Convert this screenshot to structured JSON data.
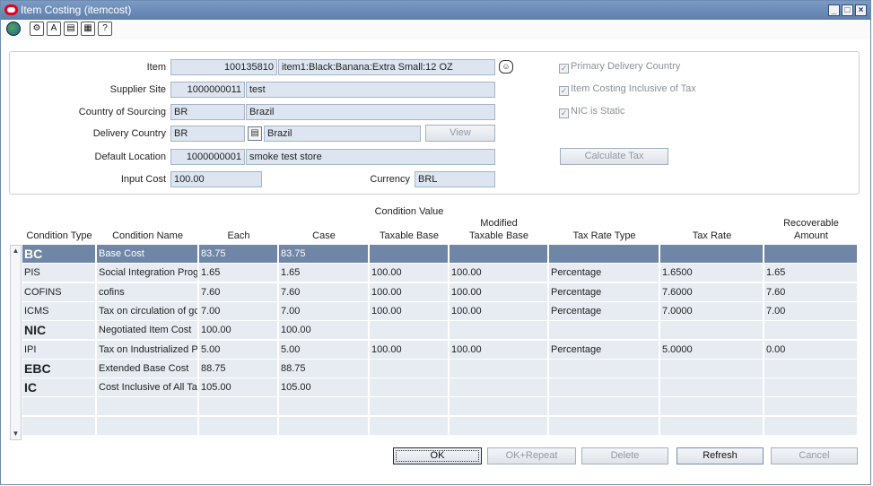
{
  "window": {
    "title": "Item Costing (itemcost)"
  },
  "toolbar": {
    "icons": [
      "globe-icon",
      "settings-icon",
      "find-icon",
      "clipboard-icon",
      "document-icon",
      "help-icon"
    ],
    "glyphs": [
      "",
      "⚙",
      "A",
      "▤",
      "▦",
      "?"
    ]
  },
  "form": {
    "item_label": "Item",
    "item_id": "100135810",
    "item_desc": "item1:Black:Banana:Extra Small:12 OZ",
    "supplier_site_label": "Supplier Site",
    "supplier_site_id": "1000000011",
    "supplier_site_name": "test",
    "country_sourcing_label": "Country of Sourcing",
    "country_sourcing_code": "BR",
    "country_sourcing_name": "Brazil",
    "delivery_country_label": "Delivery Country",
    "delivery_country_code": "BR",
    "delivery_country_name": "Brazil",
    "view_button": "View",
    "default_location_label": "Default Location",
    "default_location_id": "1000000001",
    "default_location_name": "smoke test store",
    "input_cost_label": "Input Cost",
    "input_cost": "100.00",
    "currency_label": "Currency",
    "currency": "BRL",
    "primary_delivery_country": "Primary Delivery Country",
    "item_costing_inclusive": "Item Costing Inclusive of Tax",
    "nic_is_static": "NIC is Static",
    "calculate_tax_button": "Calculate Tax"
  },
  "grid": {
    "group_header": "Condition Value",
    "columns": {
      "condition_type": "Condition Type",
      "condition_name": "Condition Name",
      "each": "Each",
      "case": "Case",
      "taxable_base": "Taxable Base",
      "modified_line1": "Modified",
      "modified_line2": "Taxable Base",
      "tax_rate_type": "Tax Rate Type",
      "tax_rate": "Tax Rate",
      "recoverable_line1": "Recoverable",
      "recoverable_line2": "Amount"
    },
    "rows": [
      {
        "type": "BC",
        "name": "Base Cost",
        "each": "83.75",
        "case": "83.75",
        "taxable_base": "",
        "modified_base": "",
        "rate_type": "",
        "rate": "",
        "recoverable": "",
        "big": true,
        "selected": true
      },
      {
        "type": "PIS",
        "name": "Social Integration Progr",
        "each": "1.65",
        "case": "1.65",
        "taxable_base": "100.00",
        "modified_base": "100.00",
        "rate_type": "Percentage",
        "rate": "1.6500",
        "recoverable": "1.65",
        "big": false
      },
      {
        "type": "COFINS",
        "name": "cofins",
        "each": "7.60",
        "case": "7.60",
        "taxable_base": "100.00",
        "modified_base": "100.00",
        "rate_type": "Percentage",
        "rate": "7.6000",
        "recoverable": "7.60",
        "big": false
      },
      {
        "type": "ICMS",
        "name": "Tax on circulation of gc",
        "each": "7.00",
        "case": "7.00",
        "taxable_base": "100.00",
        "modified_base": "100.00",
        "rate_type": "Percentage",
        "rate": "7.0000",
        "recoverable": "7.00",
        "big": false
      },
      {
        "type": "NIC",
        "name": "Negotiated Item Cost",
        "each": "100.00",
        "case": "100.00",
        "taxable_base": "",
        "modified_base": "",
        "rate_type": "",
        "rate": "",
        "recoverable": "",
        "big": true
      },
      {
        "type": "IPI",
        "name": "Tax on Industrialized Pr",
        "each": "5.00",
        "case": "5.00",
        "taxable_base": "100.00",
        "modified_base": "100.00",
        "rate_type": "Percentage",
        "rate": "5.0000",
        "recoverable": "0.00",
        "big": false
      },
      {
        "type": "EBC",
        "name": "Extended Base Cost",
        "each": "88.75",
        "case": "88.75",
        "taxable_base": "",
        "modified_base": "",
        "rate_type": "",
        "rate": "",
        "recoverable": "",
        "big": true
      },
      {
        "type": "IC",
        "name": "Cost Inclusive of All Ta",
        "each": "105.00",
        "case": "105.00",
        "taxable_base": "",
        "modified_base": "",
        "rate_type": "",
        "rate": "",
        "recoverable": "",
        "big": true
      },
      {
        "type": "",
        "name": "",
        "each": "",
        "case": "",
        "taxable_base": "",
        "modified_base": "",
        "rate_type": "",
        "rate": "",
        "recoverable": "",
        "big": false
      },
      {
        "type": "",
        "name": "",
        "each": "",
        "case": "",
        "taxable_base": "",
        "modified_base": "",
        "rate_type": "",
        "rate": "",
        "recoverable": "",
        "big": false
      }
    ]
  },
  "footer": {
    "ok": "OK",
    "ok_repeat": "OK+Repeat",
    "delete": "Delete",
    "refresh": "Refresh",
    "cancel": "Cancel"
  },
  "colors": {
    "titlebar": "#5e80ad",
    "selected_row": "#6f86a6",
    "field_bg": "#dde6f0"
  }
}
